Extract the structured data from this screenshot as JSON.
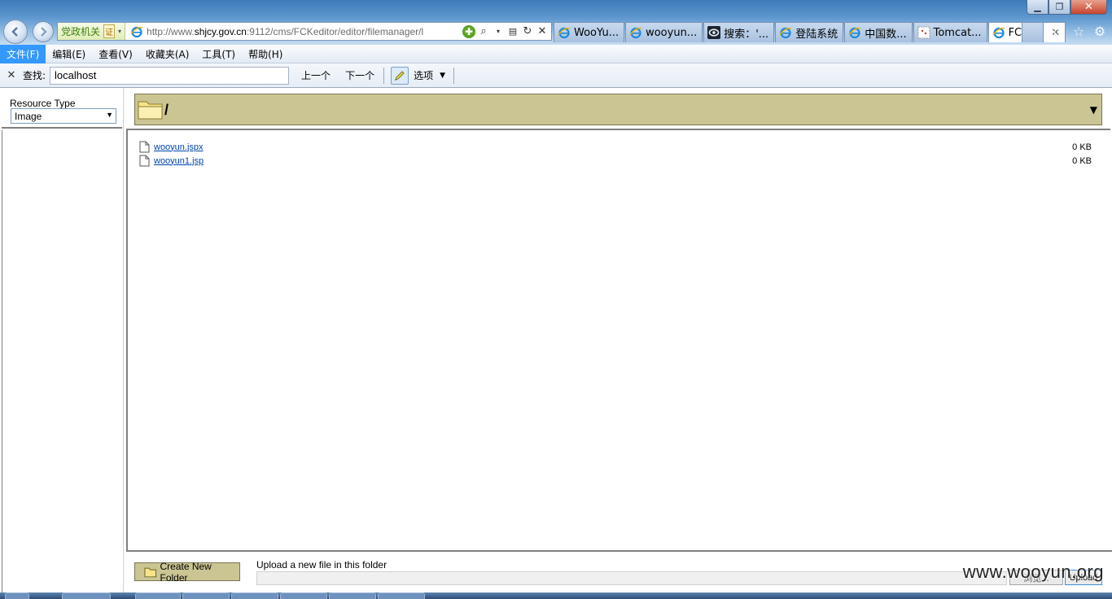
{
  "browser": {
    "address": {
      "cert_label": "党政机关",
      "cert_mark": "证",
      "url_prefix": "http://www.",
      "url_domain": "shjcy.gov.cn",
      "url_rest": ":9112/cms/FCKeditor/editor/filemanager/l"
    },
    "tabs": [
      {
        "label": "WooYu...",
        "icon": "ie-icon"
      },
      {
        "label": "wooyun...",
        "icon": "ie-icon"
      },
      {
        "label": "搜索：'...",
        "icon": "eye-icon"
      },
      {
        "label": "登陆系统",
        "icon": "ie-icon"
      },
      {
        "label": "中国数...",
        "icon": "ie-icon"
      },
      {
        "label": "Tomcat...",
        "icon": "tomcat-icon"
      },
      {
        "label": "FCKe...",
        "icon": "ie-icon",
        "active": true
      }
    ],
    "menu": [
      "文件(F)",
      "编辑(E)",
      "查看(V)",
      "收藏夹(A)",
      "工具(T)",
      "帮助(H)"
    ],
    "find": {
      "label": "查找:",
      "value": "localhost",
      "prev": "上一个",
      "next": "下一个",
      "options": "选项"
    }
  },
  "filemanager": {
    "resource_type_label": "Resource Type",
    "resource_type_value": "Image",
    "current_path": "/",
    "files": [
      {
        "name": "wooyun.jspx",
        "size": "0 KB"
      },
      {
        "name": "wooyun1.jsp",
        "size": "0 KB"
      }
    ],
    "create_folder_label": "Create New Folder",
    "upload_label": "Upload a new file in this folder",
    "browse_label": "浏览...",
    "upload_button": "Upload"
  },
  "watermark": "www.wooyun.org",
  "colors": {
    "panel_khaki": "#cbc594",
    "menu_active": "#3399ff",
    "link": "#0044aa"
  }
}
